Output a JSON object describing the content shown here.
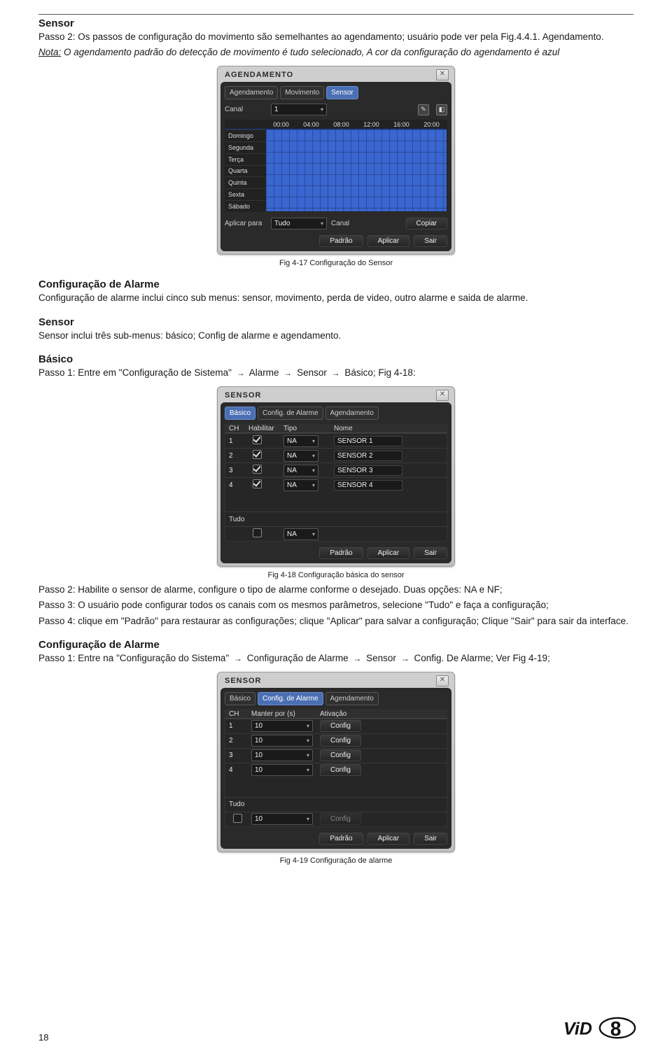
{
  "text": {
    "sec_sensor": "Sensor",
    "p_sensor_step2": "Passo 2: Os passos de configuração do movimento são semelhantes ao agendamento; usuário pode ver pela Fig.4.4.1. Agendamento.",
    "nota_label": "Nota:",
    "nota_body": " O agendamento padrão do detecção de movimento é tudo selecionado, A cor da configuração do agendamento é azul",
    "cap_417": "Fig 4-17 Configuração do Sensor",
    "sec_conf_alarme": "Configuração de Alarme",
    "p_conf_alarme": "Configuração de alarme inclui cinco sub menus: sensor, movimento, perda de video, outro alarme e saida de alarme.",
    "sec_sensor2": "Sensor",
    "p_sensor_incl": "Sensor inclui três sub-menus: básico; Config de alarme e agendamento.",
    "sec_basico": "Básico",
    "p_basico_step1": "Passo 1: Entre em \"Configuração de Sistema\"       Alarme       Sensor       Básico; Fig 4-18:",
    "word_alarme": "Alarme",
    "word_sensor": "Sensor",
    "word_basico": "Básico; Fig 4-18:",
    "p_basico_step1_prefix": "Passo 1: Entre em \"Configuração de Sistema\"",
    "cap_418": "Fig 4-18 Configuração básica do sensor",
    "p_step2b": "Passo 2: Habilite o sensor de alarme, configure o tipo de alarme conforme o desejado. Duas opções: NA e NF;",
    "p_step3b": "Passo 3: O usuário pode configurar todos os canais com os mesmos parâmetros, selecione \"Tudo\" e faça a configuração;",
    "p_step4b": "Passo 4: clique em \"Padrão\" para restaurar as configurações; clique \"Aplicar\" para salvar a configuração; Clique \"Sair\" para sair da interface.",
    "sec_conf_alarme2": "Configuração de Alarme",
    "p_ca_step1_prefix": "Passo 1: Entre na \"Configuração do Sistema\"",
    "p_ca_word1": "Configuração de Alarme",
    "p_ca_word2": "Sensor",
    "p_ca_word3": "Config. De Alarme; Ver Fig 4-19;",
    "cap_419": "Fig 4-19 Configuração de alarme",
    "page_number": "18"
  },
  "ui1": {
    "title": "AGENDAMENTO",
    "tabs": [
      "Agendamento",
      "Movimento",
      "Sensor"
    ],
    "sel_tab": 2,
    "canal_lbl": "Canal",
    "canal_val": "1",
    "hours": [
      "00:00",
      "04:00",
      "08:00",
      "12:00",
      "16:00",
      "20:00"
    ],
    "days": [
      "Domingo",
      "Segunda",
      "Terça",
      "Quarta",
      "Quinta",
      "Sexta",
      "Sábado"
    ],
    "aplicar_lbl": "Aplicar para",
    "aplicar_val": "Tudo",
    "canal_btn_lbl": "Canal",
    "copiar_btn": "Copiar",
    "btn_padrao": "Padrão",
    "btn_aplicar": "Aplicar",
    "btn_sair": "Sair"
  },
  "ui2": {
    "title": "SENSOR",
    "tabs": [
      "Básico",
      "Config. de Alarme",
      "Agendamento"
    ],
    "sel_tab": 0,
    "col_ch": "CH",
    "col_hab": "Habilitar",
    "col_tipo": "Tipo",
    "col_nome": "Nome",
    "rows": [
      {
        "ch": "1",
        "tipo": "NA",
        "nome": "SENSOR 1"
      },
      {
        "ch": "2",
        "tipo": "NA",
        "nome": "SENSOR 2"
      },
      {
        "ch": "3",
        "tipo": "NA",
        "nome": "SENSOR 3"
      },
      {
        "ch": "4",
        "tipo": "NA",
        "nome": "SENSOR 4"
      }
    ],
    "tudo": "Tudo",
    "tudo_tipo": "NA",
    "btn_padrao": "Padrão",
    "btn_aplicar": "Aplicar",
    "btn_sair": "Sair"
  },
  "ui3": {
    "title": "SENSOR",
    "tabs": [
      "Básico",
      "Config. de Alarme",
      "Agendamento"
    ],
    "sel_tab": 1,
    "col_ch": "CH",
    "col_hold": "Manter por (s)",
    "col_ativ": "Ativação",
    "rows": [
      {
        "ch": "1",
        "hold": "10",
        "btn": "Config"
      },
      {
        "ch": "2",
        "hold": "10",
        "btn": "Config"
      },
      {
        "ch": "3",
        "hold": "10",
        "btn": "Config"
      },
      {
        "ch": "4",
        "hold": "10",
        "btn": "Config"
      }
    ],
    "tudo": "Tudo",
    "tudo_hold": "10",
    "tudo_btn": "Config",
    "btn_padrao": "Padrão",
    "btn_aplicar": "Aplicar",
    "btn_sair": "Sair"
  }
}
